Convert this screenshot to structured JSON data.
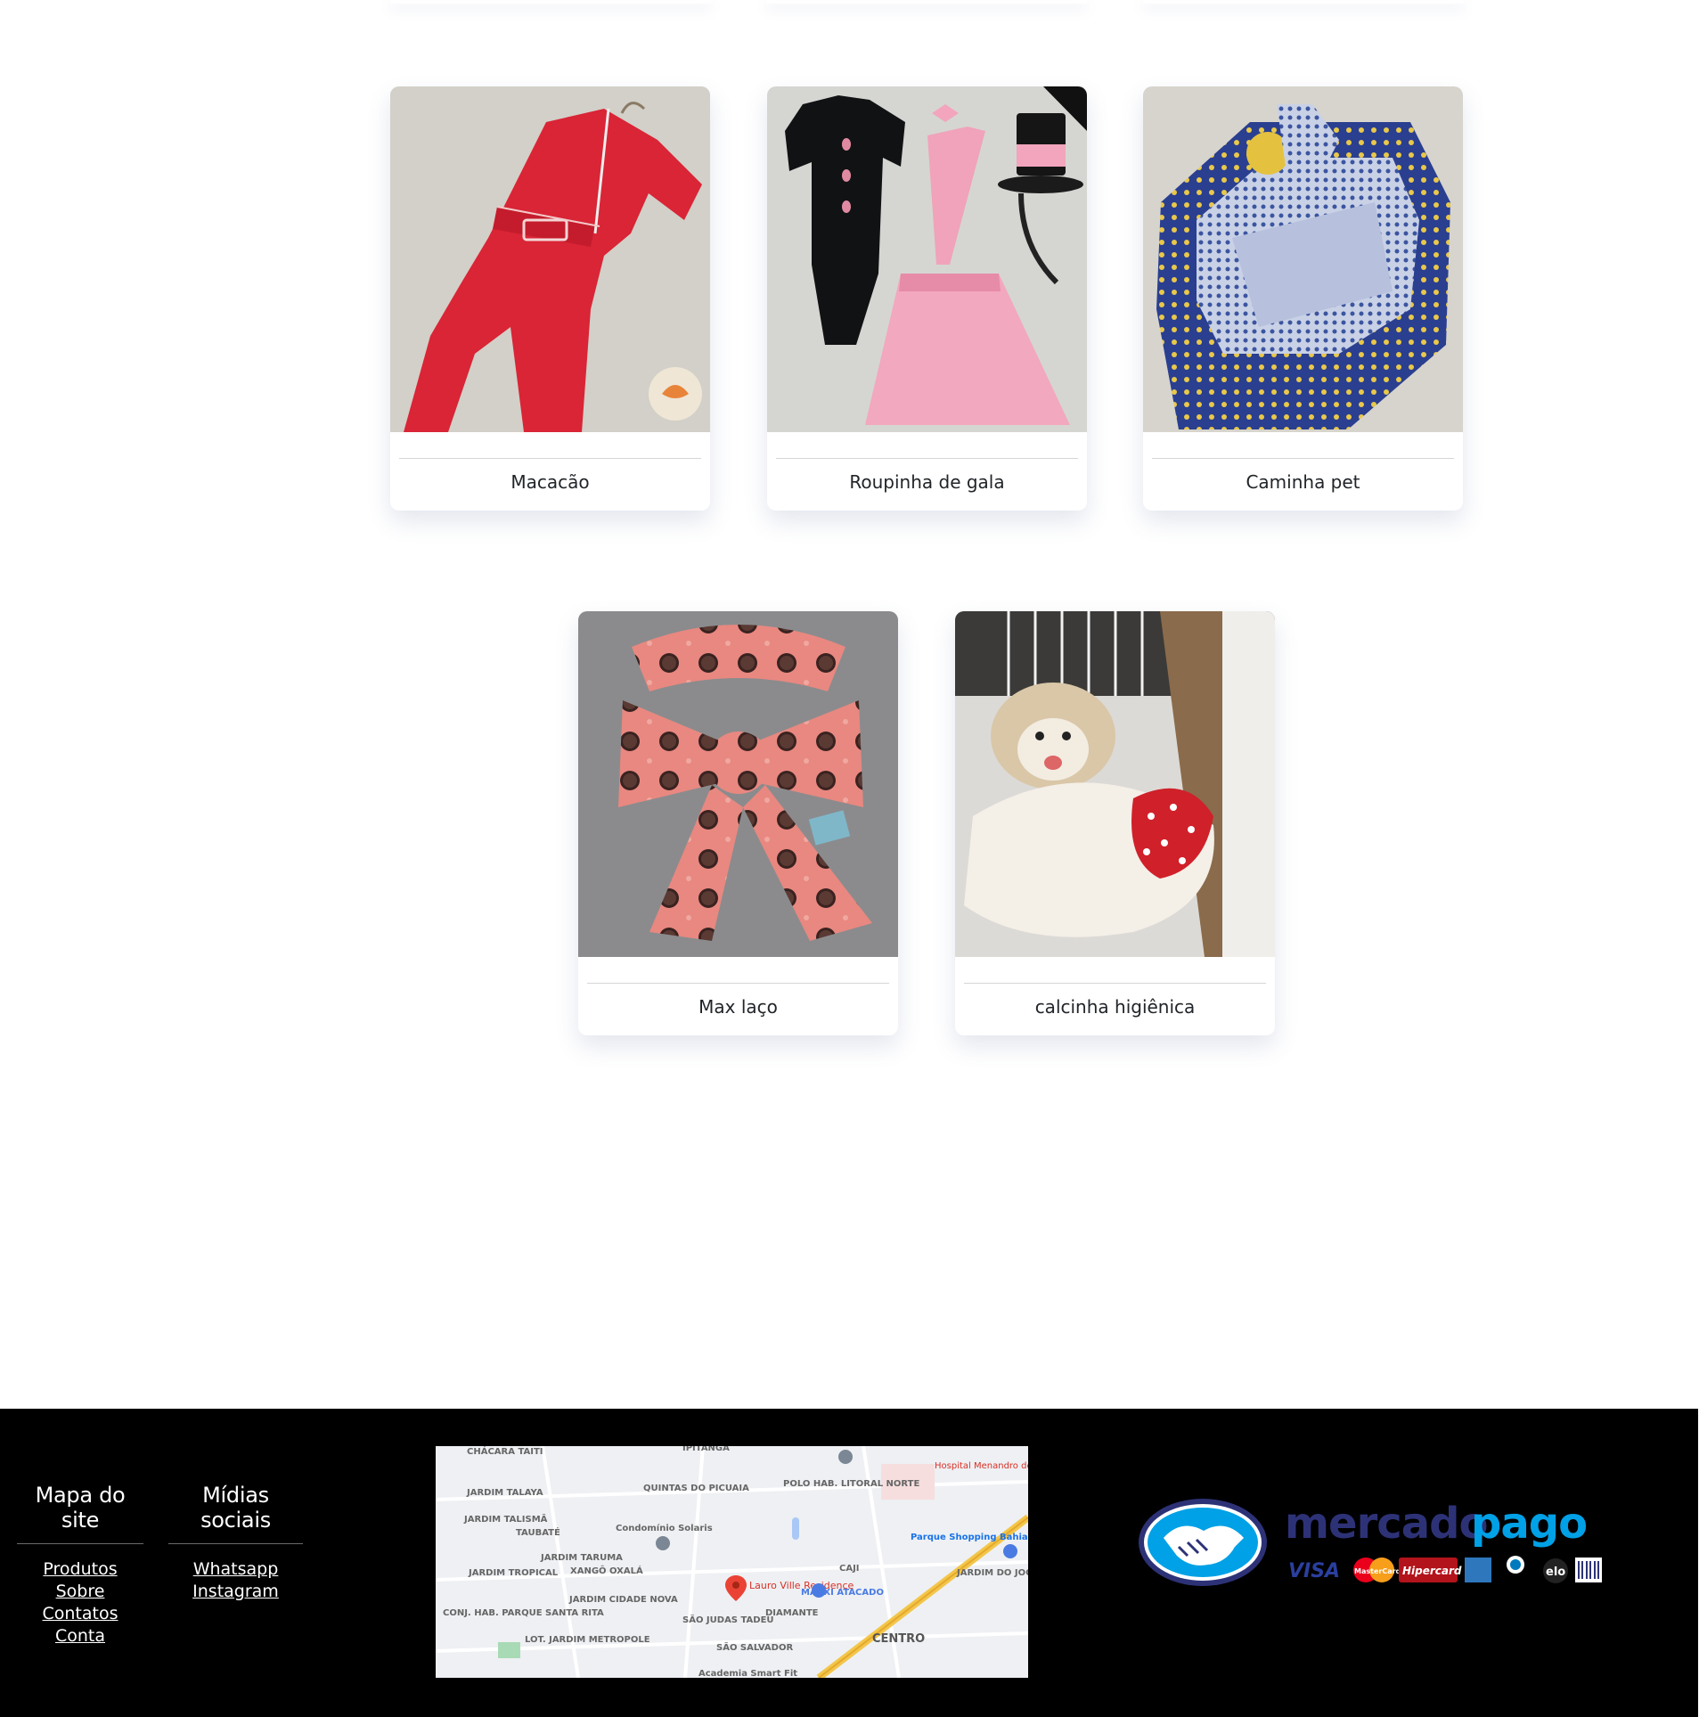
{
  "products": [
    {
      "name": "Macacão",
      "image": "red-jumpsuit-photo"
    },
    {
      "name": "Roupinha de gala",
      "image": "black-bodysuit-pink-skirt-top-hat-photo"
    },
    {
      "name": "Caminha pet",
      "image": "blue-patterned-pet-bed-photo"
    },
    {
      "name": "Max laço",
      "image": "pink-cookie-print-bow-photo"
    },
    {
      "name": "calcinha higiênica",
      "image": "dog-wearing-red-polka-dot-panty-photo"
    }
  ],
  "footer": {
    "sitemap": {
      "title": "Mapa do site",
      "links": [
        "Produtos",
        "Sobre",
        "Contatos",
        "Conta"
      ]
    },
    "social": {
      "title": "Mídias sociais",
      "links": [
        "Whatsapp",
        "Instagram"
      ]
    },
    "map": {
      "pin_label": "Lauro Ville Residence",
      "labels": [
        "CHÁCARA TAITI",
        "IPITANGA",
        "JARDIM TALAYA",
        "QUINTAS DO PICUAIA",
        "POLO HAB. LITORAL NORTE",
        "JARDIM TALISMÃ",
        "TAUBATÉ",
        "Condomínio Solaris",
        "Parque Shopping Bahia",
        "JARDIM TARUMA",
        "JARDIM TROPICAL",
        "XANGÔ OXALÁ",
        "CAJI",
        "JARDIM DO JOCKEY",
        "MAXXI ATACADO",
        "JARDIM CIDADE NOVA",
        "DIAMANTE",
        "CONJ. HAB. PARQUE SANTA RITA",
        "SÃO JUDAS TADEU",
        "CENTRO",
        "LOT. JARDIM METROPOLE",
        "SÃO SALVADOR",
        "Academia Smart Fit",
        "Hospital Menandro de"
      ]
    },
    "payment": {
      "brand": "mercadopago",
      "brand_part1": "mercado",
      "brand_part2": "pago",
      "cards": [
        "VISA",
        "MasterCard",
        "Hipercard",
        "American Express",
        "Diners",
        "elo",
        "Boleto"
      ]
    }
  },
  "colors": {
    "footer_bg": "#000000",
    "mp_blue": "#2d3277",
    "mp_light_blue": "#00a1e6"
  }
}
